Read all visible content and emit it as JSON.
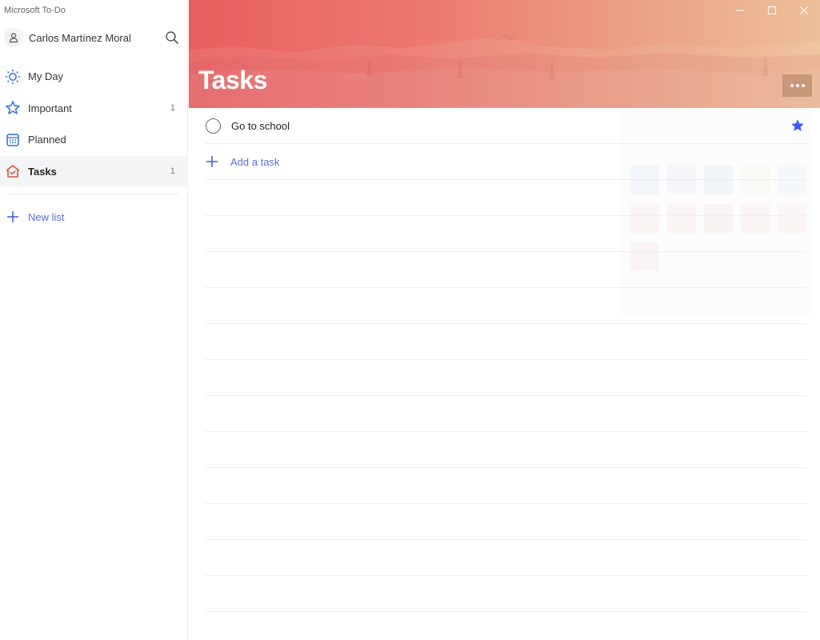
{
  "app": {
    "title": "Microsoft To-Do"
  },
  "user": {
    "name": "Carlos Martínez Moral",
    "avatar_icon": "person-icon",
    "search_icon": "search-icon"
  },
  "sidebar": {
    "items": [
      {
        "label": "My Day",
        "icon": "sun-icon",
        "count": "",
        "active": false
      },
      {
        "label": "Important",
        "icon": "star-icon",
        "count": "1",
        "active": false
      },
      {
        "label": "Planned",
        "icon": "calendar-icon",
        "count": "",
        "active": false
      },
      {
        "label": "Tasks",
        "icon": "home-check-icon",
        "count": "1",
        "active": true
      }
    ],
    "new_list_label": "New list"
  },
  "header": {
    "list_title": "Tasks",
    "more_icon": "more-options-icon",
    "window_controls": [
      "minimize",
      "maximize",
      "close"
    ]
  },
  "tasks": [
    {
      "title": "Go to school",
      "completed": false,
      "important": true
    }
  ],
  "add_task": {
    "label": "Add a task"
  },
  "colors": {
    "accent": "#5a6fd1",
    "star": "#3c5bf0",
    "header_start": "#e85f60",
    "header_end": "#edc09a",
    "tasks_icon": "#d9533e"
  }
}
